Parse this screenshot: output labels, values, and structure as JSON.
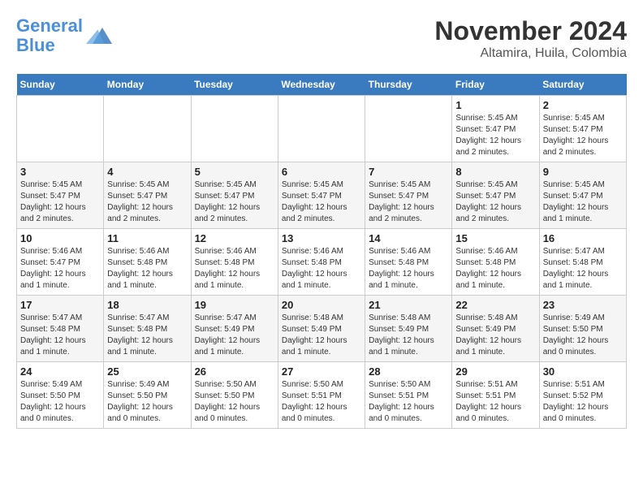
{
  "header": {
    "logo_line1": "General",
    "logo_line2": "Blue",
    "title": "November 2024",
    "subtitle": "Altamira, Huila, Colombia"
  },
  "calendar": {
    "days_of_week": [
      "Sunday",
      "Monday",
      "Tuesday",
      "Wednesday",
      "Thursday",
      "Friday",
      "Saturday"
    ],
    "weeks": [
      [
        {
          "day": "",
          "info": ""
        },
        {
          "day": "",
          "info": ""
        },
        {
          "day": "",
          "info": ""
        },
        {
          "day": "",
          "info": ""
        },
        {
          "day": "",
          "info": ""
        },
        {
          "day": "1",
          "info": "Sunrise: 5:45 AM\nSunset: 5:47 PM\nDaylight: 12 hours\nand 2 minutes."
        },
        {
          "day": "2",
          "info": "Sunrise: 5:45 AM\nSunset: 5:47 PM\nDaylight: 12 hours\nand 2 minutes."
        }
      ],
      [
        {
          "day": "3",
          "info": "Sunrise: 5:45 AM\nSunset: 5:47 PM\nDaylight: 12 hours\nand 2 minutes."
        },
        {
          "day": "4",
          "info": "Sunrise: 5:45 AM\nSunset: 5:47 PM\nDaylight: 12 hours\nand 2 minutes."
        },
        {
          "day": "5",
          "info": "Sunrise: 5:45 AM\nSunset: 5:47 PM\nDaylight: 12 hours\nand 2 minutes."
        },
        {
          "day": "6",
          "info": "Sunrise: 5:45 AM\nSunset: 5:47 PM\nDaylight: 12 hours\nand 2 minutes."
        },
        {
          "day": "7",
          "info": "Sunrise: 5:45 AM\nSunset: 5:47 PM\nDaylight: 12 hours\nand 2 minutes."
        },
        {
          "day": "8",
          "info": "Sunrise: 5:45 AM\nSunset: 5:47 PM\nDaylight: 12 hours\nand 2 minutes."
        },
        {
          "day": "9",
          "info": "Sunrise: 5:45 AM\nSunset: 5:47 PM\nDaylight: 12 hours\nand 1 minute."
        }
      ],
      [
        {
          "day": "10",
          "info": "Sunrise: 5:46 AM\nSunset: 5:47 PM\nDaylight: 12 hours\nand 1 minute."
        },
        {
          "day": "11",
          "info": "Sunrise: 5:46 AM\nSunset: 5:48 PM\nDaylight: 12 hours\nand 1 minute."
        },
        {
          "day": "12",
          "info": "Sunrise: 5:46 AM\nSunset: 5:48 PM\nDaylight: 12 hours\nand 1 minute."
        },
        {
          "day": "13",
          "info": "Sunrise: 5:46 AM\nSunset: 5:48 PM\nDaylight: 12 hours\nand 1 minute."
        },
        {
          "day": "14",
          "info": "Sunrise: 5:46 AM\nSunset: 5:48 PM\nDaylight: 12 hours\nand 1 minute."
        },
        {
          "day": "15",
          "info": "Sunrise: 5:46 AM\nSunset: 5:48 PM\nDaylight: 12 hours\nand 1 minute."
        },
        {
          "day": "16",
          "info": "Sunrise: 5:47 AM\nSunset: 5:48 PM\nDaylight: 12 hours\nand 1 minute."
        }
      ],
      [
        {
          "day": "17",
          "info": "Sunrise: 5:47 AM\nSunset: 5:48 PM\nDaylight: 12 hours\nand 1 minute."
        },
        {
          "day": "18",
          "info": "Sunrise: 5:47 AM\nSunset: 5:48 PM\nDaylight: 12 hours\nand 1 minute."
        },
        {
          "day": "19",
          "info": "Sunrise: 5:47 AM\nSunset: 5:49 PM\nDaylight: 12 hours\nand 1 minute."
        },
        {
          "day": "20",
          "info": "Sunrise: 5:48 AM\nSunset: 5:49 PM\nDaylight: 12 hours\nand 1 minute."
        },
        {
          "day": "21",
          "info": "Sunrise: 5:48 AM\nSunset: 5:49 PM\nDaylight: 12 hours\nand 1 minute."
        },
        {
          "day": "22",
          "info": "Sunrise: 5:48 AM\nSunset: 5:49 PM\nDaylight: 12 hours\nand 1 minute."
        },
        {
          "day": "23",
          "info": "Sunrise: 5:49 AM\nSunset: 5:50 PM\nDaylight: 12 hours\nand 0 minutes."
        }
      ],
      [
        {
          "day": "24",
          "info": "Sunrise: 5:49 AM\nSunset: 5:50 PM\nDaylight: 12 hours\nand 0 minutes."
        },
        {
          "day": "25",
          "info": "Sunrise: 5:49 AM\nSunset: 5:50 PM\nDaylight: 12 hours\nand 0 minutes."
        },
        {
          "day": "26",
          "info": "Sunrise: 5:50 AM\nSunset: 5:50 PM\nDaylight: 12 hours\nand 0 minutes."
        },
        {
          "day": "27",
          "info": "Sunrise: 5:50 AM\nSunset: 5:51 PM\nDaylight: 12 hours\nand 0 minutes."
        },
        {
          "day": "28",
          "info": "Sunrise: 5:50 AM\nSunset: 5:51 PM\nDaylight: 12 hours\nand 0 minutes."
        },
        {
          "day": "29",
          "info": "Sunrise: 5:51 AM\nSunset: 5:51 PM\nDaylight: 12 hours\nand 0 minutes."
        },
        {
          "day": "30",
          "info": "Sunrise: 5:51 AM\nSunset: 5:52 PM\nDaylight: 12 hours\nand 0 minutes."
        }
      ]
    ]
  }
}
